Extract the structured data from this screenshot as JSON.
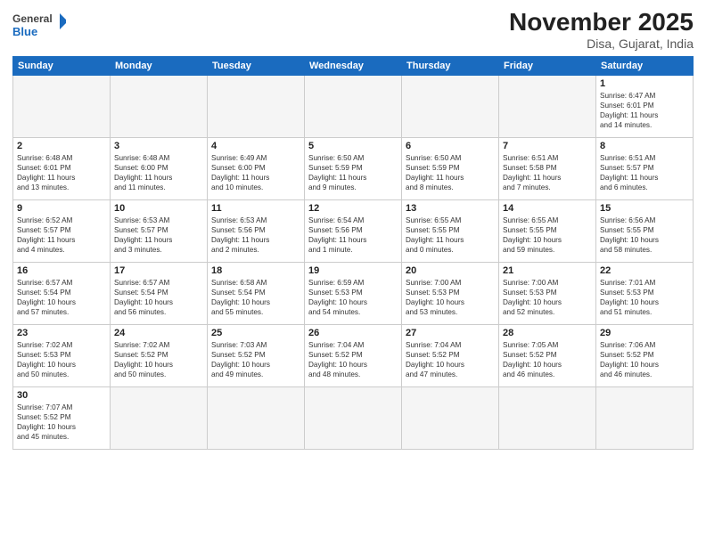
{
  "header": {
    "logo_general": "General",
    "logo_blue": "Blue",
    "month_title": "November 2025",
    "subtitle": "Disa, Gujarat, India"
  },
  "weekdays": [
    "Sunday",
    "Monday",
    "Tuesday",
    "Wednesday",
    "Thursday",
    "Friday",
    "Saturday"
  ],
  "weeks": [
    [
      {
        "day": "",
        "info": ""
      },
      {
        "day": "",
        "info": ""
      },
      {
        "day": "",
        "info": ""
      },
      {
        "day": "",
        "info": ""
      },
      {
        "day": "",
        "info": ""
      },
      {
        "day": "",
        "info": ""
      },
      {
        "day": "1",
        "info": "Sunrise: 6:47 AM\nSunset: 6:01 PM\nDaylight: 11 hours\nand 14 minutes."
      }
    ],
    [
      {
        "day": "2",
        "info": "Sunrise: 6:48 AM\nSunset: 6:01 PM\nDaylight: 11 hours\nand 13 minutes."
      },
      {
        "day": "3",
        "info": "Sunrise: 6:48 AM\nSunset: 6:00 PM\nDaylight: 11 hours\nand 11 minutes."
      },
      {
        "day": "4",
        "info": "Sunrise: 6:49 AM\nSunset: 6:00 PM\nDaylight: 11 hours\nand 10 minutes."
      },
      {
        "day": "5",
        "info": "Sunrise: 6:50 AM\nSunset: 5:59 PM\nDaylight: 11 hours\nand 9 minutes."
      },
      {
        "day": "6",
        "info": "Sunrise: 6:50 AM\nSunset: 5:59 PM\nDaylight: 11 hours\nand 8 minutes."
      },
      {
        "day": "7",
        "info": "Sunrise: 6:51 AM\nSunset: 5:58 PM\nDaylight: 11 hours\nand 7 minutes."
      },
      {
        "day": "8",
        "info": "Sunrise: 6:51 AM\nSunset: 5:57 PM\nDaylight: 11 hours\nand 6 minutes."
      }
    ],
    [
      {
        "day": "9",
        "info": "Sunrise: 6:52 AM\nSunset: 5:57 PM\nDaylight: 11 hours\nand 4 minutes."
      },
      {
        "day": "10",
        "info": "Sunrise: 6:53 AM\nSunset: 5:57 PM\nDaylight: 11 hours\nand 3 minutes."
      },
      {
        "day": "11",
        "info": "Sunrise: 6:53 AM\nSunset: 5:56 PM\nDaylight: 11 hours\nand 2 minutes."
      },
      {
        "day": "12",
        "info": "Sunrise: 6:54 AM\nSunset: 5:56 PM\nDaylight: 11 hours\nand 1 minute."
      },
      {
        "day": "13",
        "info": "Sunrise: 6:55 AM\nSunset: 5:55 PM\nDaylight: 11 hours\nand 0 minutes."
      },
      {
        "day": "14",
        "info": "Sunrise: 6:55 AM\nSunset: 5:55 PM\nDaylight: 10 hours\nand 59 minutes."
      },
      {
        "day": "15",
        "info": "Sunrise: 6:56 AM\nSunset: 5:55 PM\nDaylight: 10 hours\nand 58 minutes."
      }
    ],
    [
      {
        "day": "16",
        "info": "Sunrise: 6:57 AM\nSunset: 5:54 PM\nDaylight: 10 hours\nand 57 minutes."
      },
      {
        "day": "17",
        "info": "Sunrise: 6:57 AM\nSunset: 5:54 PM\nDaylight: 10 hours\nand 56 minutes."
      },
      {
        "day": "18",
        "info": "Sunrise: 6:58 AM\nSunset: 5:54 PM\nDaylight: 10 hours\nand 55 minutes."
      },
      {
        "day": "19",
        "info": "Sunrise: 6:59 AM\nSunset: 5:53 PM\nDaylight: 10 hours\nand 54 minutes."
      },
      {
        "day": "20",
        "info": "Sunrise: 7:00 AM\nSunset: 5:53 PM\nDaylight: 10 hours\nand 53 minutes."
      },
      {
        "day": "21",
        "info": "Sunrise: 7:00 AM\nSunset: 5:53 PM\nDaylight: 10 hours\nand 52 minutes."
      },
      {
        "day": "22",
        "info": "Sunrise: 7:01 AM\nSunset: 5:53 PM\nDaylight: 10 hours\nand 51 minutes."
      }
    ],
    [
      {
        "day": "23",
        "info": "Sunrise: 7:02 AM\nSunset: 5:53 PM\nDaylight: 10 hours\nand 50 minutes."
      },
      {
        "day": "24",
        "info": "Sunrise: 7:02 AM\nSunset: 5:52 PM\nDaylight: 10 hours\nand 50 minutes."
      },
      {
        "day": "25",
        "info": "Sunrise: 7:03 AM\nSunset: 5:52 PM\nDaylight: 10 hours\nand 49 minutes."
      },
      {
        "day": "26",
        "info": "Sunrise: 7:04 AM\nSunset: 5:52 PM\nDaylight: 10 hours\nand 48 minutes."
      },
      {
        "day": "27",
        "info": "Sunrise: 7:04 AM\nSunset: 5:52 PM\nDaylight: 10 hours\nand 47 minutes."
      },
      {
        "day": "28",
        "info": "Sunrise: 7:05 AM\nSunset: 5:52 PM\nDaylight: 10 hours\nand 46 minutes."
      },
      {
        "day": "29",
        "info": "Sunrise: 7:06 AM\nSunset: 5:52 PM\nDaylight: 10 hours\nand 46 minutes."
      }
    ],
    [
      {
        "day": "30",
        "info": "Sunrise: 7:07 AM\nSunset: 5:52 PM\nDaylight: 10 hours\nand 45 minutes."
      },
      {
        "day": "",
        "info": ""
      },
      {
        "day": "",
        "info": ""
      },
      {
        "day": "",
        "info": ""
      },
      {
        "day": "",
        "info": ""
      },
      {
        "day": "",
        "info": ""
      },
      {
        "day": "",
        "info": ""
      }
    ]
  ]
}
